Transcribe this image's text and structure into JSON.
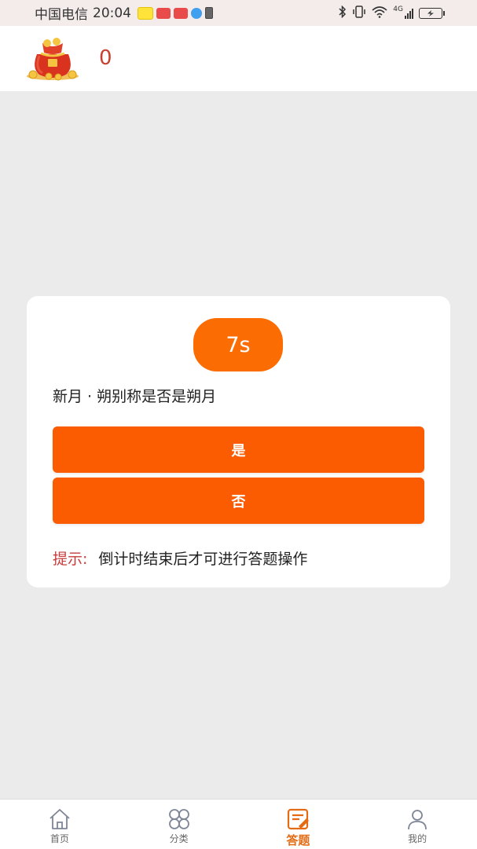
{
  "status_bar": {
    "carrier": "中国电信",
    "time": "20:04",
    "network": "4G"
  },
  "header": {
    "coin_count": "0"
  },
  "quiz": {
    "countdown": "7s",
    "question": "新月 · 朔别称是否是朔月",
    "answers": {
      "yes": "是",
      "no": "否"
    },
    "hint_label": "提示:",
    "hint_text": "倒计时结束后才可进行答题操作"
  },
  "nav": {
    "items": [
      {
        "label": "首页",
        "icon": "home-icon"
      },
      {
        "label": "分类",
        "icon": "category-icon"
      },
      {
        "label": "答题",
        "icon": "quiz-icon",
        "active": true
      },
      {
        "label": "我的",
        "icon": "profile-icon"
      }
    ]
  },
  "colors": {
    "accent": "#fb5c01",
    "timer": "#fb6c03",
    "coin": "#c8402f",
    "hint_label": "#c63b3b",
    "nav_active": "#e46b14",
    "background": "#ebebeb"
  }
}
